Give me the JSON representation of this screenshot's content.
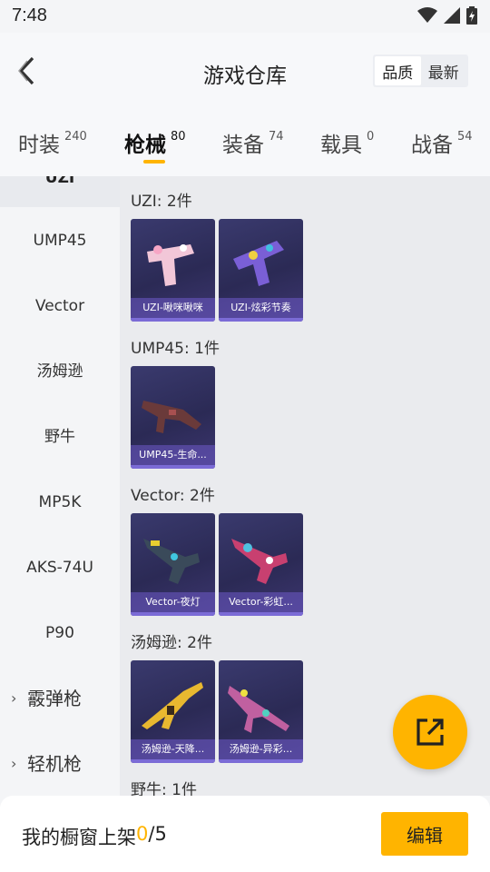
{
  "status_bar": {
    "time": "7:48"
  },
  "header": {
    "title": "游戏仓库",
    "sort_options": [
      "品质",
      "最新"
    ],
    "active_sort": "品质"
  },
  "tabs": [
    {
      "label": "时装",
      "count": "240"
    },
    {
      "label": "枪械",
      "count": "80",
      "active": true
    },
    {
      "label": "装备",
      "count": "74"
    },
    {
      "label": "载具",
      "count": "0"
    },
    {
      "label": "战备",
      "count": "54"
    }
  ],
  "sidebar": {
    "selected": "UZI",
    "items": [
      "UMP45",
      "Vector",
      "汤姆逊",
      "野牛",
      "MP5K",
      "AKS-74U",
      "P90"
    ],
    "groups": [
      "霰弹枪",
      "轻机枪"
    ]
  },
  "sections": [
    {
      "title": "UZI: 2件",
      "items": [
        "UZI-啾咪啾咪",
        "UZI-炫彩节奏"
      ]
    },
    {
      "title": "UMP45: 1件",
      "items": [
        "UMP45-生命..."
      ]
    },
    {
      "title": "Vector: 2件",
      "items": [
        "Vector-夜灯",
        "Vector-彩虹..."
      ]
    },
    {
      "title": "汤姆逊: 2件",
      "items": [
        "汤姆逊-天降...",
        "汤姆逊-异彩..."
      ]
    },
    {
      "title": "野牛: 1件",
      "items": []
    }
  ],
  "bottom_bar": {
    "shelf_label": "我的橱窗上架 ",
    "shelf_count": "0",
    "shelf_total": "/5",
    "edit_label": "编辑"
  },
  "colors": {
    "accent": "#ffb400",
    "card_bg": "#2b2a55",
    "card_label_bg": "#6e5ac8"
  }
}
